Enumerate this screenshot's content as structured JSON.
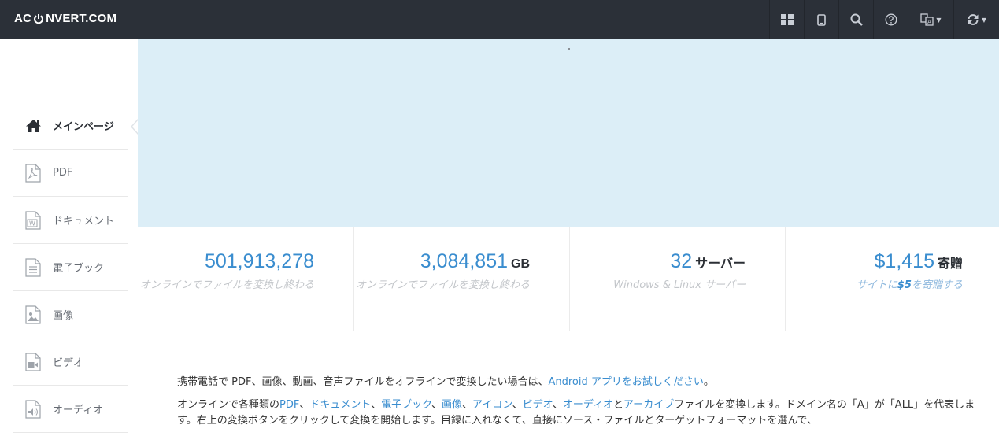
{
  "header": {
    "logo_left": "AC",
    "logo_right": "NVERT.COM"
  },
  "topbar_icons": [
    "apps-grid-icon",
    "mobile-icon",
    "search-icon",
    "help-icon",
    "language-icon",
    "convert-refresh-icon"
  ],
  "sidebar": {
    "items": [
      {
        "label": "メインページ",
        "icon": "home-icon"
      },
      {
        "label": "PDF",
        "icon": "pdf-file-icon"
      },
      {
        "label": "ドキュメント",
        "icon": "word-file-icon"
      },
      {
        "label": "電子ブック",
        "icon": "ebook-file-icon"
      },
      {
        "label": "画像",
        "icon": "image-file-icon"
      },
      {
        "label": "ビデオ",
        "icon": "video-file-icon"
      },
      {
        "label": "オーディオ",
        "icon": "audio-file-icon"
      }
    ]
  },
  "stats": [
    {
      "value": "501,913,278",
      "unit": "",
      "caption": "オンラインでファイルを変換し終わる"
    },
    {
      "value": "3,084,851",
      "unit": "GB",
      "caption": "オンラインでファイルを変換し終わる"
    },
    {
      "value": "32",
      "unit": "サーバー",
      "caption": "Windows & Linux サーバー"
    },
    {
      "value": "$1,415",
      "unit": "寄贈",
      "caption_pre": "サイトに",
      "caption_amount": "$5",
      "caption_post": "を寄贈する"
    }
  ],
  "content": {
    "p1_text": "携帯電話で PDF、画像、動画、音声ファイルをオフラインで変換したい場合は、",
    "p1_link": "Android アプリをお試しください",
    "p1_end": "。",
    "p2_start": "オンラインで各種類の",
    "p2_links": [
      "PDF",
      "ドキュメント",
      "電子ブック",
      "画像",
      "アイコン",
      "ビデオ",
      "オーディオ",
      "アーカイブ"
    ],
    "p2_sep": "、",
    "p2_and": "と",
    "p2_end": "ファイルを変換します。ドメイン名の「A」が「ALL」を代表します。右上の変換ボタンをクリックして変換を開始します。目録に入れなくて、直接にソース・ファイルとターゲットフォーマットを選んで、"
  },
  "colors": {
    "topbar": "#2b3038",
    "banner": "#dceef7",
    "accent": "#3a8dcf"
  }
}
